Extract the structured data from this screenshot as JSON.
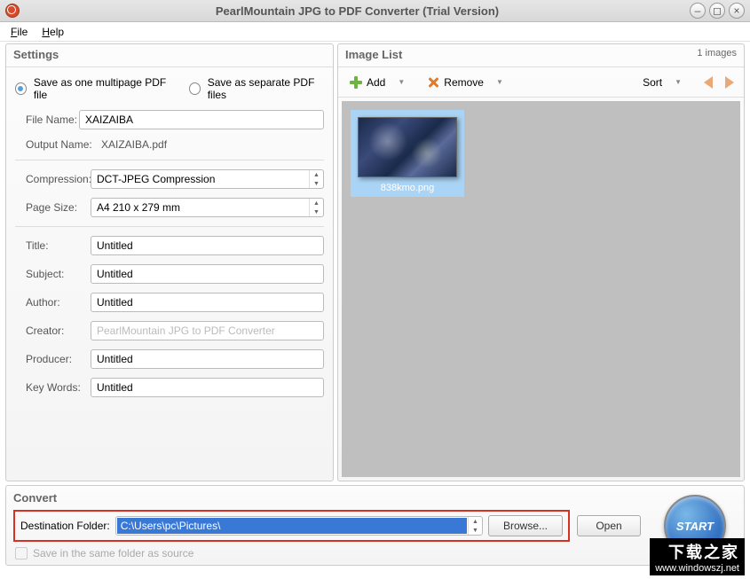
{
  "window": {
    "title": "PearlMountain JPG to PDF Converter (Trial Version)"
  },
  "menu": {
    "file": "File",
    "help": "Help"
  },
  "settings": {
    "header": "Settings",
    "radio_multipage": "Save as one multipage PDF file",
    "radio_separate": "Save as separate PDF files",
    "filename_label": "File Name:",
    "filename_value": "XAIZAIBA",
    "outputname_label": "Output Name:",
    "outputname_value": "XAIZAIBA.pdf",
    "compression_label": "Compression:",
    "compression_value": "DCT-JPEG Compression",
    "pagesize_label": "Page Size:",
    "pagesize_value": "A4 210 x 279 mm",
    "title_label": "Title:",
    "title_value": "Untitled",
    "subject_label": "Subject:",
    "subject_value": "Untitled",
    "author_label": "Author:",
    "author_value": "Untitled",
    "creator_label": "Creator:",
    "creator_value": "PearlMountain JPG to PDF Converter",
    "producer_label": "Producer:",
    "producer_value": "Untitled",
    "keywords_label": "Key Words:",
    "keywords_value": "Untitled"
  },
  "imagelist": {
    "header": "Image List",
    "count": "1 images",
    "add": "Add",
    "remove": "Remove",
    "sort": "Sort",
    "thumb_name": "838kmo.png"
  },
  "convert": {
    "header": "Convert",
    "destfolder_label": "Destination Folder:",
    "destfolder_value": "C:\\Users\\pc\\Pictures\\",
    "browse": "Browse...",
    "open": "Open",
    "same_folder": "Save in the same folder as source",
    "start": "START"
  },
  "watermark": {
    "cn": "下载之家",
    "url": "www.windowszj.net"
  }
}
